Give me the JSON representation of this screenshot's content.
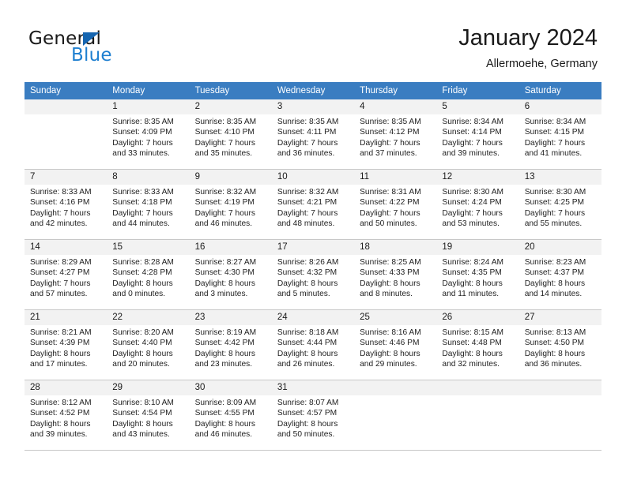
{
  "brand": {
    "name_part1": "General",
    "name_part2": "Blue",
    "triangle_icon": "triangle-icon",
    "accent_color": "#1e7fd0"
  },
  "header": {
    "title": "January 2024",
    "subtitle": "Allermoehe, Germany"
  },
  "colors": {
    "header_row_bg": "#3a7dc1",
    "daynum_bg": "#f2f2f2",
    "grid_line": "#c8c8c8",
    "text": "#222222"
  },
  "calendar": {
    "weekday_headers": [
      "Sunday",
      "Monday",
      "Tuesday",
      "Wednesday",
      "Thursday",
      "Friday",
      "Saturday"
    ],
    "weeks": [
      [
        {
          "day": "",
          "empty": true,
          "info": ""
        },
        {
          "day": "1",
          "empty": false,
          "info": "Sunrise: 8:35 AM\nSunset: 4:09 PM\nDaylight: 7 hours\nand 33 minutes."
        },
        {
          "day": "2",
          "empty": false,
          "info": "Sunrise: 8:35 AM\nSunset: 4:10 PM\nDaylight: 7 hours\nand 35 minutes."
        },
        {
          "day": "3",
          "empty": false,
          "info": "Sunrise: 8:35 AM\nSunset: 4:11 PM\nDaylight: 7 hours\nand 36 minutes."
        },
        {
          "day": "4",
          "empty": false,
          "info": "Sunrise: 8:35 AM\nSunset: 4:12 PM\nDaylight: 7 hours\nand 37 minutes."
        },
        {
          "day": "5",
          "empty": false,
          "info": "Sunrise: 8:34 AM\nSunset: 4:14 PM\nDaylight: 7 hours\nand 39 minutes."
        },
        {
          "day": "6",
          "empty": false,
          "info": "Sunrise: 8:34 AM\nSunset: 4:15 PM\nDaylight: 7 hours\nand 41 minutes."
        }
      ],
      [
        {
          "day": "7",
          "empty": false,
          "info": "Sunrise: 8:33 AM\nSunset: 4:16 PM\nDaylight: 7 hours\nand 42 minutes."
        },
        {
          "day": "8",
          "empty": false,
          "info": "Sunrise: 8:33 AM\nSunset: 4:18 PM\nDaylight: 7 hours\nand 44 minutes."
        },
        {
          "day": "9",
          "empty": false,
          "info": "Sunrise: 8:32 AM\nSunset: 4:19 PM\nDaylight: 7 hours\nand 46 minutes."
        },
        {
          "day": "10",
          "empty": false,
          "info": "Sunrise: 8:32 AM\nSunset: 4:21 PM\nDaylight: 7 hours\nand 48 minutes."
        },
        {
          "day": "11",
          "empty": false,
          "info": "Sunrise: 8:31 AM\nSunset: 4:22 PM\nDaylight: 7 hours\nand 50 minutes."
        },
        {
          "day": "12",
          "empty": false,
          "info": "Sunrise: 8:30 AM\nSunset: 4:24 PM\nDaylight: 7 hours\nand 53 minutes."
        },
        {
          "day": "13",
          "empty": false,
          "info": "Sunrise: 8:30 AM\nSunset: 4:25 PM\nDaylight: 7 hours\nand 55 minutes."
        }
      ],
      [
        {
          "day": "14",
          "empty": false,
          "info": "Sunrise: 8:29 AM\nSunset: 4:27 PM\nDaylight: 7 hours\nand 57 minutes."
        },
        {
          "day": "15",
          "empty": false,
          "info": "Sunrise: 8:28 AM\nSunset: 4:28 PM\nDaylight: 8 hours\nand 0 minutes."
        },
        {
          "day": "16",
          "empty": false,
          "info": "Sunrise: 8:27 AM\nSunset: 4:30 PM\nDaylight: 8 hours\nand 3 minutes."
        },
        {
          "day": "17",
          "empty": false,
          "info": "Sunrise: 8:26 AM\nSunset: 4:32 PM\nDaylight: 8 hours\nand 5 minutes."
        },
        {
          "day": "18",
          "empty": false,
          "info": "Sunrise: 8:25 AM\nSunset: 4:33 PM\nDaylight: 8 hours\nand 8 minutes."
        },
        {
          "day": "19",
          "empty": false,
          "info": "Sunrise: 8:24 AM\nSunset: 4:35 PM\nDaylight: 8 hours\nand 11 minutes."
        },
        {
          "day": "20",
          "empty": false,
          "info": "Sunrise: 8:23 AM\nSunset: 4:37 PM\nDaylight: 8 hours\nand 14 minutes."
        }
      ],
      [
        {
          "day": "21",
          "empty": false,
          "info": "Sunrise: 8:21 AM\nSunset: 4:39 PM\nDaylight: 8 hours\nand 17 minutes."
        },
        {
          "day": "22",
          "empty": false,
          "info": "Sunrise: 8:20 AM\nSunset: 4:40 PM\nDaylight: 8 hours\nand 20 minutes."
        },
        {
          "day": "23",
          "empty": false,
          "info": "Sunrise: 8:19 AM\nSunset: 4:42 PM\nDaylight: 8 hours\nand 23 minutes."
        },
        {
          "day": "24",
          "empty": false,
          "info": "Sunrise: 8:18 AM\nSunset: 4:44 PM\nDaylight: 8 hours\nand 26 minutes."
        },
        {
          "day": "25",
          "empty": false,
          "info": "Sunrise: 8:16 AM\nSunset: 4:46 PM\nDaylight: 8 hours\nand 29 minutes."
        },
        {
          "day": "26",
          "empty": false,
          "info": "Sunrise: 8:15 AM\nSunset: 4:48 PM\nDaylight: 8 hours\nand 32 minutes."
        },
        {
          "day": "27",
          "empty": false,
          "info": "Sunrise: 8:13 AM\nSunset: 4:50 PM\nDaylight: 8 hours\nand 36 minutes."
        }
      ],
      [
        {
          "day": "28",
          "empty": false,
          "info": "Sunrise: 8:12 AM\nSunset: 4:52 PM\nDaylight: 8 hours\nand 39 minutes."
        },
        {
          "day": "29",
          "empty": false,
          "info": "Sunrise: 8:10 AM\nSunset: 4:54 PM\nDaylight: 8 hours\nand 43 minutes."
        },
        {
          "day": "30",
          "empty": false,
          "info": "Sunrise: 8:09 AM\nSunset: 4:55 PM\nDaylight: 8 hours\nand 46 minutes."
        },
        {
          "day": "31",
          "empty": false,
          "info": "Sunrise: 8:07 AM\nSunset: 4:57 PM\nDaylight: 8 hours\nand 50 minutes."
        },
        {
          "day": "",
          "empty": true,
          "info": ""
        },
        {
          "day": "",
          "empty": true,
          "info": ""
        },
        {
          "day": "",
          "empty": true,
          "info": ""
        }
      ]
    ]
  }
}
